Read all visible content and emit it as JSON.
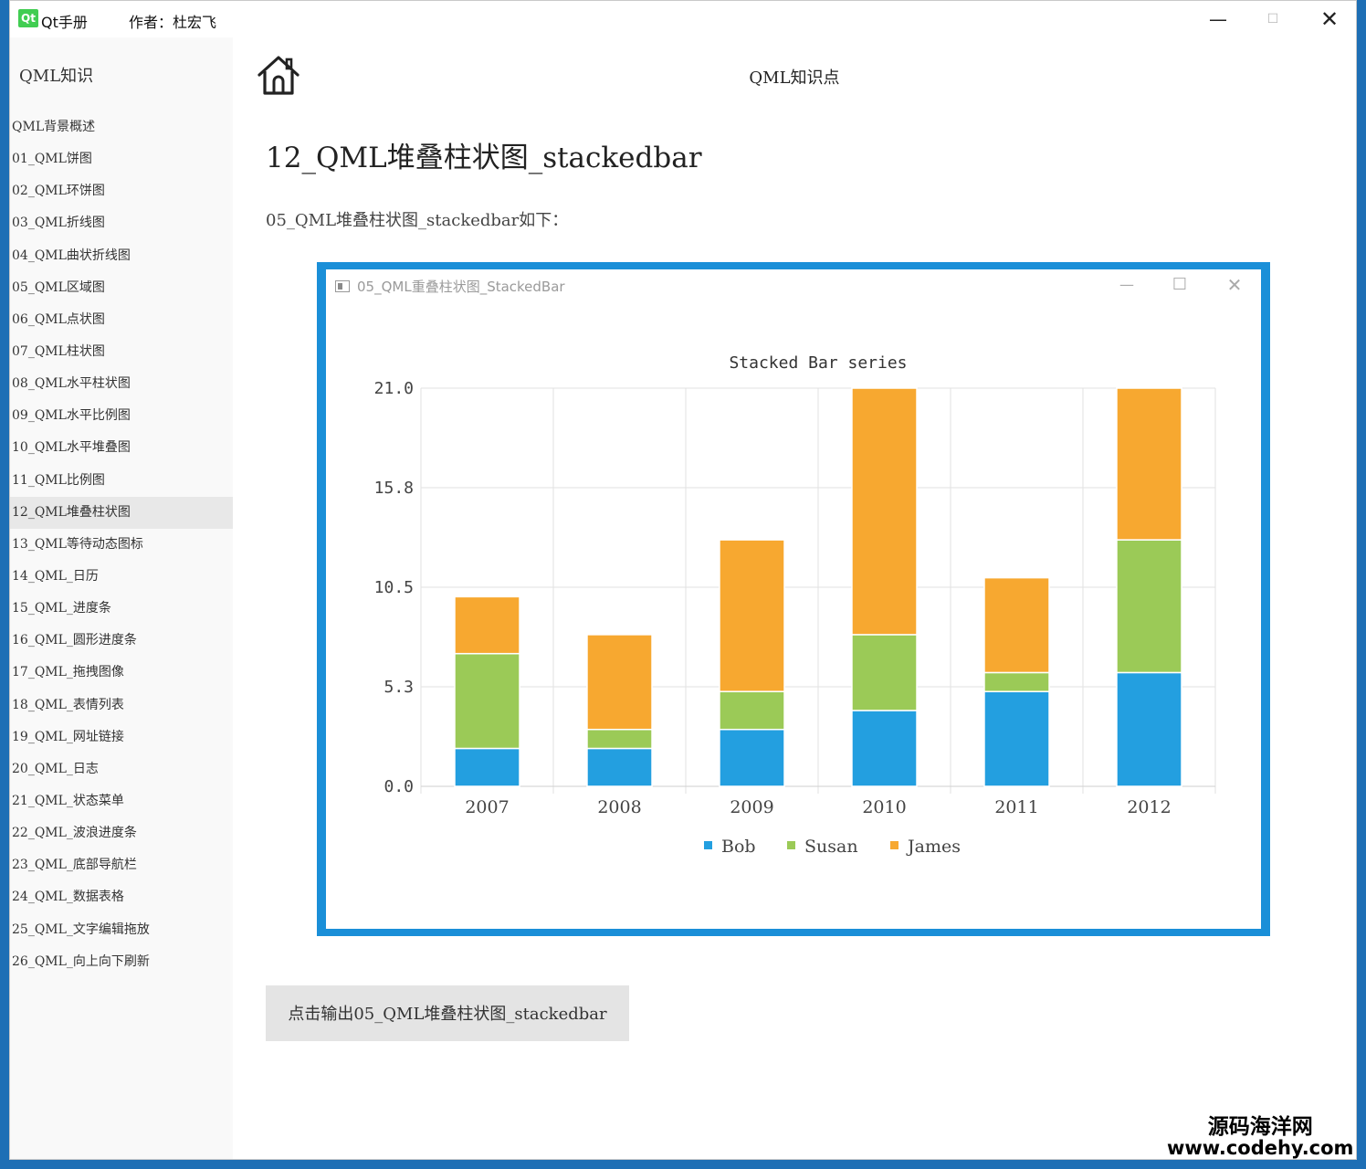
{
  "window": {
    "app_title": "Qt手册",
    "author": "作者：杜宏飞",
    "logo_text": "Qt",
    "min_glyph": "—",
    "max_glyph": "☐",
    "close_glyph": "✕"
  },
  "sidebar": {
    "title": "QML知识",
    "items": [
      {
        "label": "QML背景概述"
      },
      {
        "label": "01_QML饼图"
      },
      {
        "label": "02_QML环饼图"
      },
      {
        "label": "03_QML折线图"
      },
      {
        "label": "04_QML曲状折线图"
      },
      {
        "label": "05_QML区域图"
      },
      {
        "label": "06_QML点状图"
      },
      {
        "label": "07_QML柱状图"
      },
      {
        "label": "08_QML水平柱状图"
      },
      {
        "label": "09_QML水平比例图"
      },
      {
        "label": "10_QML水平堆叠图"
      },
      {
        "label": "11_QML比例图"
      },
      {
        "label": "12_QML堆叠柱状图",
        "active": true
      },
      {
        "label": "13_QML等待动态图标"
      },
      {
        "label": "14_QML_日历"
      },
      {
        "label": "15_QML_进度条"
      },
      {
        "label": "16_QML_圆形进度条"
      },
      {
        "label": "17_QML_拖拽图像"
      },
      {
        "label": "18_QML_表情列表"
      },
      {
        "label": "19_QML_网址链接"
      },
      {
        "label": "20_QML_日志"
      },
      {
        "label": "21_QML_状态菜单"
      },
      {
        "label": "22_QML_波浪进度条"
      },
      {
        "label": "23_QML_底部导航栏"
      },
      {
        "label": "24_QML_数据表格"
      },
      {
        "label": "25_QML_文字编辑拖放"
      },
      {
        "label": "26_QML_向上向下刷新"
      }
    ]
  },
  "main": {
    "header_title": "QML知识点",
    "page_title": "12_QML堆叠柱状图_stackedbar",
    "description": "05_QML堆叠柱状图_stackedbar如下：",
    "output_button_label": "点击输出05_QML堆叠柱状图_stackedbar"
  },
  "screenshot_window": {
    "title": "05_QML重叠柱状图_StackedBar",
    "min_glyph": "—",
    "max_glyph": "☐",
    "close_glyph": "✕"
  },
  "chart_data": {
    "type": "bar",
    "stacked": true,
    "title": "Stacked Bar series",
    "xlabel": "",
    "ylabel": "",
    "categories": [
      "2007",
      "2008",
      "2009",
      "2010",
      "2011",
      "2012"
    ],
    "series": [
      {
        "name": "Bob",
        "color": "#239fe0",
        "values": [
          2,
          2,
          3,
          4,
          5,
          6
        ]
      },
      {
        "name": "Susan",
        "color": "#9bca57",
        "values": [
          5,
          1,
          2,
          4,
          1,
          7
        ]
      },
      {
        "name": "James",
        "color": "#f7a830",
        "values": [
          3,
          5,
          8,
          13,
          5,
          8
        ]
      }
    ],
    "ylim": [
      0,
      21
    ],
    "y_ticks": [
      "0.0",
      "5.3",
      "10.5",
      "15.8",
      "21.0"
    ],
    "grid": true,
    "legend": "bottom"
  },
  "watermark": {
    "line1": "源码海洋网",
    "line2": "www.codehy.com"
  }
}
